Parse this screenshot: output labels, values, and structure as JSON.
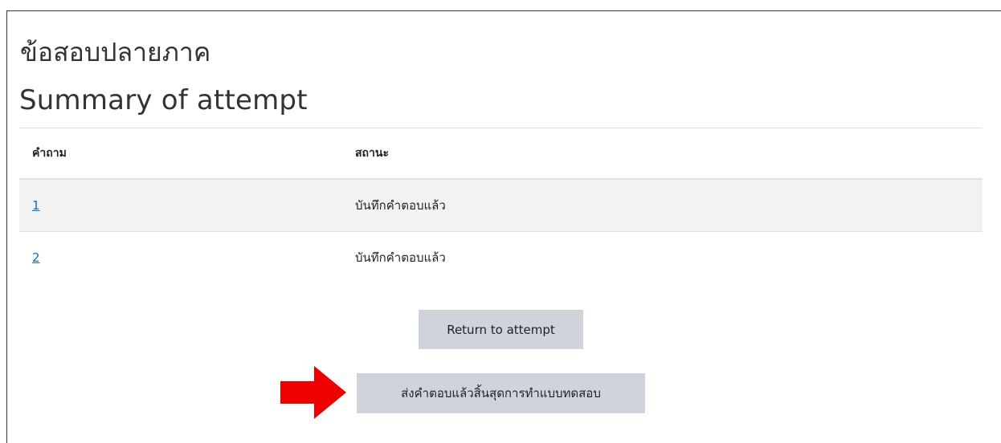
{
  "quiz": {
    "title": "ข้อสอบปลายภาค",
    "summary_heading": "Summary of attempt"
  },
  "table": {
    "headers": {
      "question": "คำถาม",
      "status": "สถานะ"
    },
    "rows": [
      {
        "question": "1",
        "status": "บันทึกคำตอบแล้ว"
      },
      {
        "question": "2",
        "status": "บันทึกคำตอบแล้ว"
      }
    ]
  },
  "actions": {
    "return_label": "Return to attempt",
    "submit_label": "ส่งคำตอบแล้วสิ้นสุดการทำแบบทดสอบ"
  },
  "annotation": {
    "arrow_icon": "arrow-right-icon",
    "arrow_color": "#ee0000"
  },
  "colors": {
    "link": "#0f6cbf",
    "button_bg": "#ced4da",
    "row_stripe": "#f2f2f2"
  }
}
